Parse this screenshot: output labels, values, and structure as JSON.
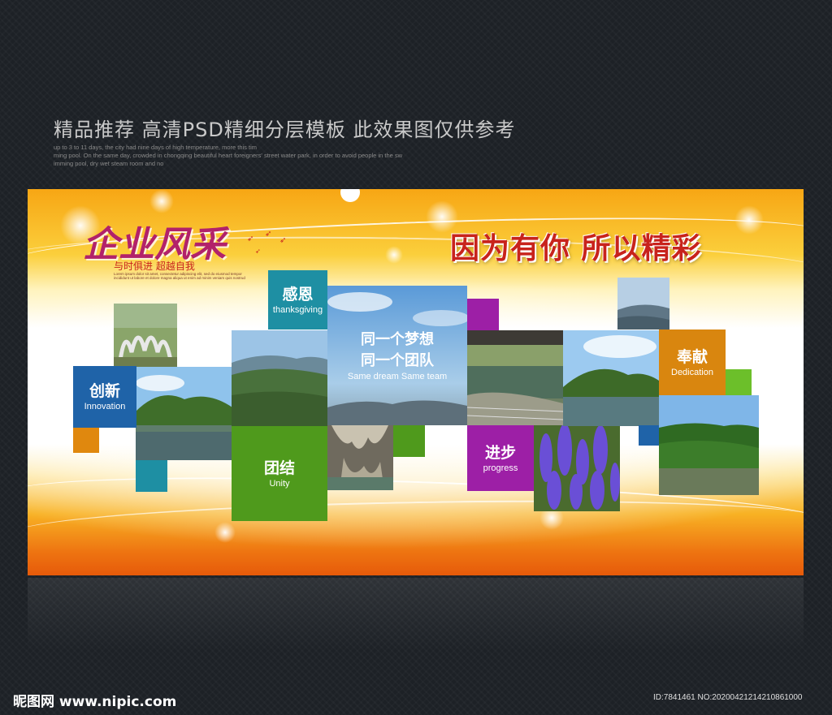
{
  "header": {
    "title": "精品推荐 高清PSD精细分层模板 此效果图仅供参考",
    "sub_lines": [
      "up to 3 to 11 days, the city had nine days of high temperature, more this tim",
      "ming pool. On the same day, crowded in chongqing beautiful heart foreigners' street water park, in order to avoid people in the sw",
      "imming pool, dry wet steam room and no"
    ]
  },
  "banner": {
    "logo": "企业风采",
    "logo_sub": "与时俱进 超越自我",
    "logo_small": "Lorem ipsum dolor sit amet, consectetur adipiscing elit, sed do eiusmod tempor incididunt ut labore et dolore magna aliqua ut enim ad minim veniam quis nostrud",
    "slogan": "因为有你 所以精彩",
    "center_line1": "同一个梦想",
    "center_line2": "同一个团队",
    "center_en": "Same dream Same team",
    "tiles": [
      {
        "cn": "创新",
        "en": "Innovation",
        "color": "#1f63a8"
      },
      {
        "cn": "感恩",
        "en": "thanksgiving",
        "color": "#1e8fa3"
      },
      {
        "cn": "团结",
        "en": "Unity",
        "color": "#4f9a1c"
      },
      {
        "cn": "进步",
        "en": "progress",
        "color": "#9d1fa6"
      },
      {
        "cn": "奉献",
        "en": "Dedication",
        "color": "#d9860f"
      }
    ],
    "accents": {
      "orange": "#e0880e",
      "teal": "#1e8fa3",
      "green": "#6cbf2a",
      "purple": "#9d1fa6",
      "blue": "#1f63a8"
    }
  },
  "footer": {
    "watermark": "昵图网 www.nipic.com",
    "id_text": "ID:7841461 NO:20200421214210861000"
  }
}
